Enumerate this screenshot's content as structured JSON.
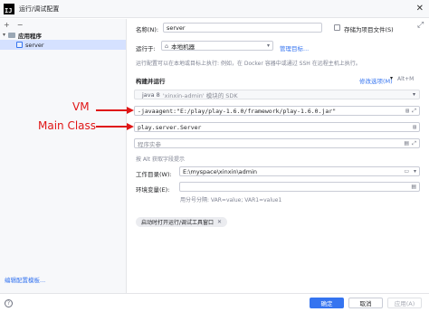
{
  "window": {
    "app_icon": "IJ",
    "title": "运行/调试配置",
    "close": "✕"
  },
  "sidebar": {
    "toolbar": {
      "add": "+",
      "remove": "−"
    },
    "groups": [
      {
        "label": "应用程序",
        "items": [
          {
            "label": "server"
          }
        ]
      }
    ],
    "edit_templates": "编辑配置模板..."
  },
  "form": {
    "name_label": "名称(N):",
    "name_value": "server",
    "store_as_project_file": "存储为项目文件(S)",
    "run_on_label": "运行于:",
    "run_on_value": "本地机器",
    "manage_targets": "管理目标...",
    "run_on_hint": "运行配置可以在本地或目标上执行: 例如，在 Docker 容器中或通过 SSH 在远程主机上执行。",
    "build_and_run": "构建并运行",
    "modify_options": "修改选项(M)",
    "modify_shortcut": "Alt+M",
    "sdk_value": "java 8",
    "sdk_suffix": "'xinxin-admin' 模块的 SDK",
    "vm_options": "-javaagent:\"E:/play/play-1.6.0/framework/play-1.6.0.jar\"",
    "main_class": "play.server.Server",
    "program_args_placeholder": "程序实参",
    "alt_hint": "按 Alt 获取字段提示",
    "workdir_label": "工作目录(W):",
    "workdir_value": "E:\\myspace\\xinxin\\admin",
    "env_label": "环境变量(E):",
    "env_hint": "用分号分隔: VAR=value; VAR1=value1",
    "open_tool_window_chip": "启动时打开运行/调试工具窗口"
  },
  "annotations": {
    "vm": "VM",
    "main_class": "Main Class"
  },
  "footer": {
    "help": "?",
    "ok": "确定",
    "cancel": "取消",
    "apply": "应用(A)"
  },
  "colors": {
    "accent": "#3574f0",
    "annotation": "#e01616",
    "selection": "#d5e1ff"
  }
}
